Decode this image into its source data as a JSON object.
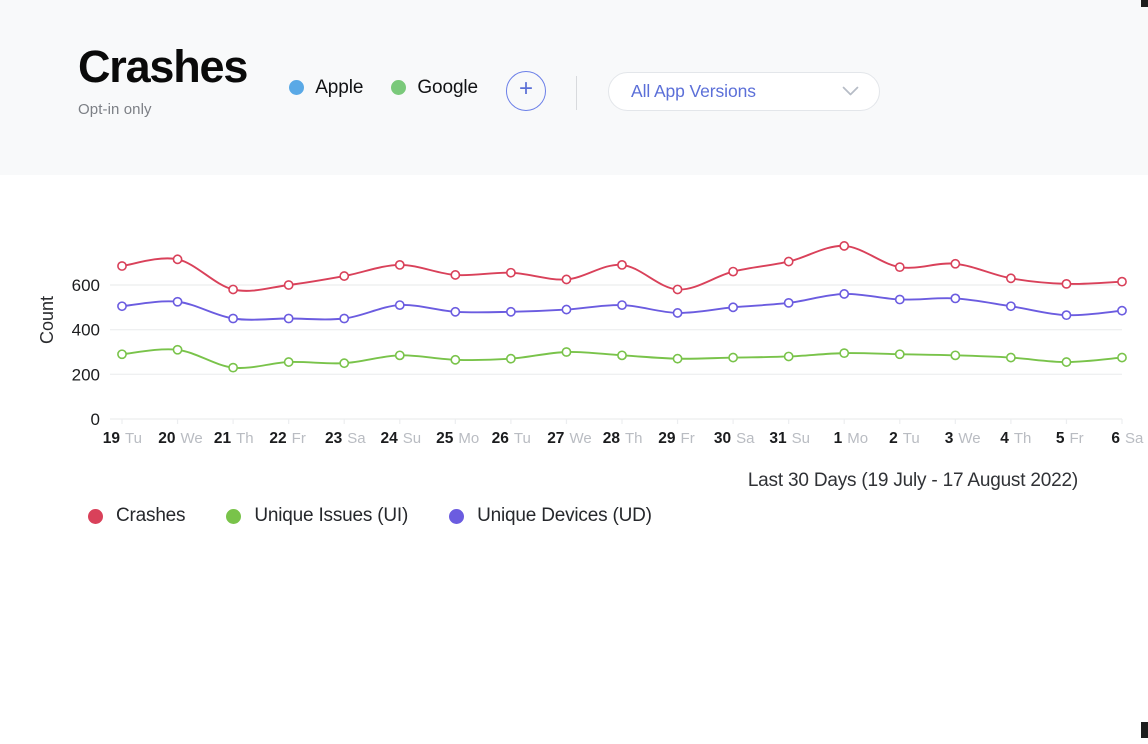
{
  "header": {
    "title": "Crashes",
    "subtitle": "Opt-in only",
    "platforms": [
      {
        "label": "Apple",
        "color": "#5aa9e6",
        "icon": "status-dot-icon"
      },
      {
        "label": "Google",
        "color": "#7ac97a",
        "icon": "status-dot-icon"
      }
    ],
    "add_button_label": "+",
    "version_select": {
      "value": "All App Versions",
      "placeholder": "All App Versions",
      "chevron_icon": "chevron-down-icon"
    }
  },
  "chart_caption": "Last 30 Days (19 July - 17 August 2022)",
  "legend": [
    {
      "label": "Crashes",
      "color": "#d9415a"
    },
    {
      "label": "Unique Issues (UI)",
      "color": "#79c34a"
    },
    {
      "label": "Unique Devices (UD)",
      "color": "#6b5ce0"
    }
  ],
  "colors": {
    "header_background": "#f8f9fa",
    "accent_blue": "#5b6fd8",
    "crashes": "#d9415a",
    "unique_issues": "#79c34a",
    "unique_devices": "#6b5ce0",
    "gridline": "#eff0f1"
  },
  "chart_data": {
    "type": "line",
    "title": "Crashes",
    "xlabel": "",
    "ylabel": "Count",
    "ylim": [
      0,
      800
    ],
    "yticks": [
      0,
      200,
      400,
      600
    ],
    "ytick_labels": [
      "0",
      "200",
      "400",
      "600"
    ],
    "grid": true,
    "legend_position": "bottom-left",
    "categories": [
      "19 Tu",
      "20 We",
      "21 Th",
      "22 Fr",
      "23 Sa",
      "24 Su",
      "25 Mo",
      "26 Tu",
      "27 We",
      "28 Th",
      "29 Fr",
      "30 Sa",
      "31 Su",
      "1 Mo",
      "2 Tu",
      "3 We",
      "4 Th",
      "5 Fr",
      "6 Sa"
    ],
    "x_day_numbers": [
      "19",
      "20",
      "21",
      "22",
      "23",
      "24",
      "25",
      "26",
      "27",
      "28",
      "29",
      "30",
      "31",
      "1",
      "2",
      "3",
      "4",
      "5",
      "6"
    ],
    "x_weekdays": [
      "Tu",
      "We",
      "Th",
      "Fr",
      "Sa",
      "Su",
      "Mo",
      "Tu",
      "We",
      "Th",
      "Fr",
      "Sa",
      "Su",
      "Mo",
      "Tu",
      "We",
      "Th",
      "Fr",
      "Sa"
    ],
    "series": [
      {
        "name": "Crashes",
        "color": "#d9415a",
        "values": [
          685,
          715,
          580,
          600,
          640,
          690,
          645,
          655,
          625,
          690,
          580,
          660,
          705,
          775,
          680,
          695,
          630,
          605,
          615
        ]
      },
      {
        "name": "Unique Devices (UD)",
        "color": "#6b5ce0",
        "values": [
          505,
          525,
          450,
          450,
          450,
          510,
          480,
          480,
          490,
          510,
          475,
          500,
          520,
          560,
          535,
          540,
          505,
          465,
          485
        ]
      },
      {
        "name": "Unique Issues (UI)",
        "color": "#79c34a",
        "values": [
          290,
          310,
          230,
          255,
          250,
          285,
          265,
          270,
          300,
          285,
          270,
          275,
          280,
          295,
          290,
          285,
          275,
          255,
          275
        ]
      }
    ]
  }
}
